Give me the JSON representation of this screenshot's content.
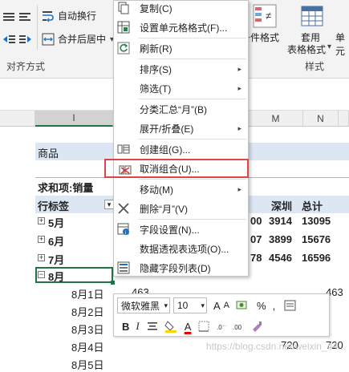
{
  "ribbon": {
    "wrap_text": "自动换行",
    "merge_center": "合并后居中",
    "align_group": "对齐方式",
    "cond_format": "条件格式",
    "table_format_1": "套用",
    "table_format_2": "表格格式",
    "cell_style": "单元",
    "style_group": "样式",
    "dropdown_arrow": "▾"
  },
  "columns": {
    "I": "I",
    "M": "M",
    "N": "N"
  },
  "sheet": {
    "product_label": "商品",
    "sum_label": "求和项:销量",
    "row_label": "行标签",
    "col_shenzhen": "深圳",
    "col_total": "总计",
    "filter_arrow": "▾",
    "rows": [
      {
        "label": "5月",
        "sign": "+",
        "partial": "00",
        "shenzhen": "3914",
        "total": "13095"
      },
      {
        "label": "6月",
        "sign": "+",
        "partial": "07",
        "shenzhen": "3899",
        "total": "15676"
      },
      {
        "label": "7月",
        "sign": "+",
        "partial": "78",
        "shenzhen": "4546",
        "total": "16596"
      },
      {
        "label": "8月",
        "sign": "−"
      }
    ],
    "detail_rows": [
      {
        "label": "8月1日",
        "partial": "463",
        "total": "463"
      },
      {
        "label": "8月2日",
        "total": ""
      },
      {
        "label": "8月3日",
        "total": ""
      },
      {
        "label": "8月4日",
        "shenzhen": "720",
        "total": "720"
      },
      {
        "label": "8月5日",
        "total": ""
      }
    ]
  },
  "menu": {
    "items": [
      {
        "label": "复制(C)",
        "icon": "copy-icon"
      },
      {
        "label": "设置单元格格式(F)...",
        "icon": "format-cells-icon"
      },
      {
        "label": "刷新(R)",
        "icon": "refresh-icon"
      },
      {
        "label": "排序(S)",
        "submenu": true
      },
      {
        "label": "筛选(T)",
        "submenu": true
      },
      {
        "label": "分类汇总“月”(B)"
      },
      {
        "label": "展开/折叠(E)",
        "submenu": true
      },
      {
        "label": "创建组(G)...",
        "icon": "group-icon"
      },
      {
        "label": "取消组合(U)...",
        "icon": "ungroup-icon",
        "highlight": true
      },
      {
        "label": "移动(M)",
        "submenu": true
      },
      {
        "label": "删除“月”(V)",
        "icon": "delete-x-icon"
      },
      {
        "label": "字段设置(N)...",
        "icon": "field-settings-icon"
      },
      {
        "label": "数据透视表选项(O)..."
      },
      {
        "label": "隐藏字段列表(D)",
        "icon": "field-list-icon"
      }
    ],
    "submenu_arrow": "▸"
  },
  "mini_toolbar": {
    "font_name": "微软雅黑",
    "font_size": "10",
    "bold": "B",
    "italic": "I",
    "percent": "%",
    "comma": ",",
    "font_color_letter": "A",
    "grow_font": "A",
    "shrink_font": "A"
  },
  "watermark": "https://blog.csdn.net/weixin_44..."
}
